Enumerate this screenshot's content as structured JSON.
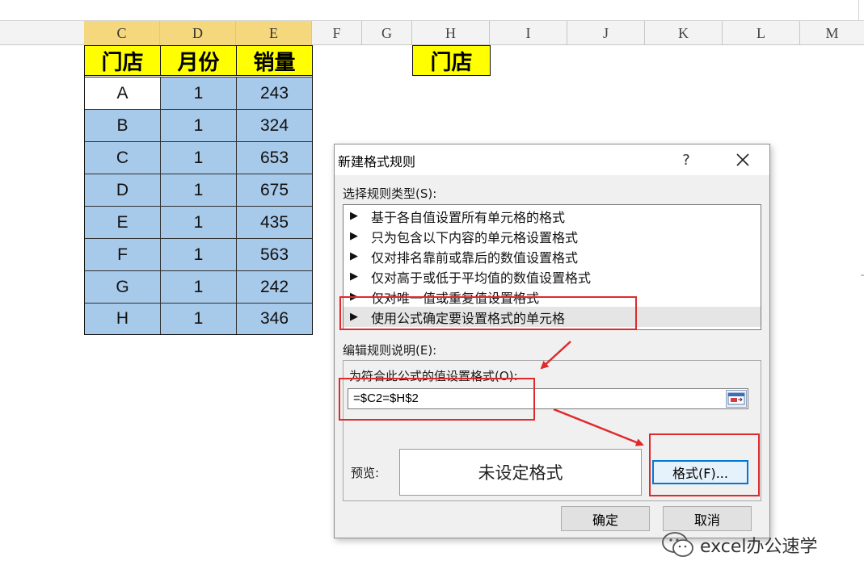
{
  "spreadsheet": {
    "columns": [
      "C",
      "D",
      "E",
      "F",
      "G",
      "H",
      "I",
      "J",
      "K",
      "L",
      "M"
    ],
    "header_cells": {
      "store": "门店",
      "month": "月份",
      "sales": "销量",
      "h_store": "门店"
    },
    "rows": [
      {
        "store": "A",
        "month": "1",
        "sales": "243"
      },
      {
        "store": "B",
        "month": "1",
        "sales": "324"
      },
      {
        "store": "C",
        "month": "1",
        "sales": "653"
      },
      {
        "store": "D",
        "month": "1",
        "sales": "675"
      },
      {
        "store": "E",
        "month": "1",
        "sales": "435"
      },
      {
        "store": "F",
        "month": "1",
        "sales": "563"
      },
      {
        "store": "G",
        "month": "1",
        "sales": "242"
      },
      {
        "store": "H",
        "month": "1",
        "sales": "346"
      }
    ]
  },
  "dialog": {
    "title": "新建格式规则",
    "help": "?",
    "rule_type_label": "选择规则类型(S):",
    "rule_types": [
      "基于各自值设置所有单元格的格式",
      "只为包含以下内容的单元格设置格式",
      "仅对排名靠前或靠后的数值设置格式",
      "仅对高于或低于平均值的数值设置格式",
      "仅对唯一值或重复值设置格式",
      "使用公式确定要设置格式的单元格"
    ],
    "rule_bullet": "▶",
    "edit_label": "编辑规则说明(E):",
    "formula_label": "为符合此公式的值设置格式(O):",
    "formula_value": "=$C2=$H$2",
    "preview_label": "预览:",
    "preview_text": "未设定格式",
    "format_button": "格式(F)...",
    "ok_button": "确定",
    "cancel_button": "取消"
  },
  "watermark": {
    "text": "excel办公速学"
  },
  "colors": {
    "header_yellow": "#ffff00",
    "cell_blue": "#a7c9ea",
    "selected_col_header": "#f5d77e",
    "annotation_red": "#e0292b"
  }
}
